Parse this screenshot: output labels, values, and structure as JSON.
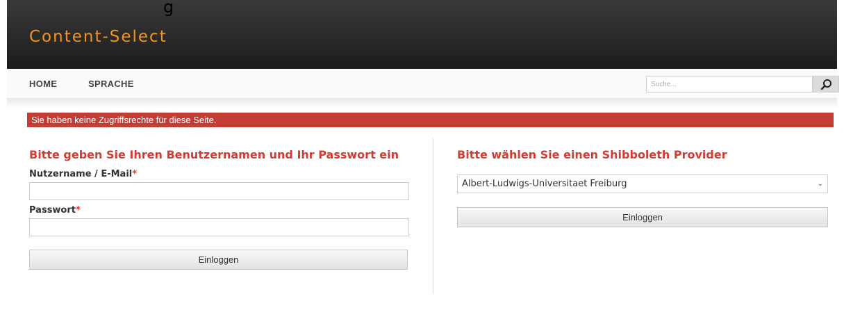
{
  "header": {
    "logo": "Content-Select",
    "cut_text": "g"
  },
  "nav": {
    "home": "HOME",
    "language": "SPRACHE",
    "search_placeholder": "Suche...",
    "search_icon": "search-icon"
  },
  "alert": {
    "message": "Sie haben keine Zugriffsrechte für diese Seite.",
    "color": "#c33d34"
  },
  "login": {
    "heading": "Bitte geben Sie Ihren Benutzernamen und Ihr Passwort ein",
    "username_label": "Nutzername / E-Mail",
    "password_label": "Passwort",
    "required_mark": "*",
    "username_value": "",
    "password_value": "",
    "submit": "Einloggen"
  },
  "shibboleth": {
    "heading": "Bitte wählen Sie einen Shibboleth Provider",
    "selected_provider": "Albert-Ludwigs-Universitaet Freiburg",
    "submit": "Einloggen"
  },
  "colors": {
    "accent": "#f2941e",
    "heading_red": "#d43b33"
  }
}
